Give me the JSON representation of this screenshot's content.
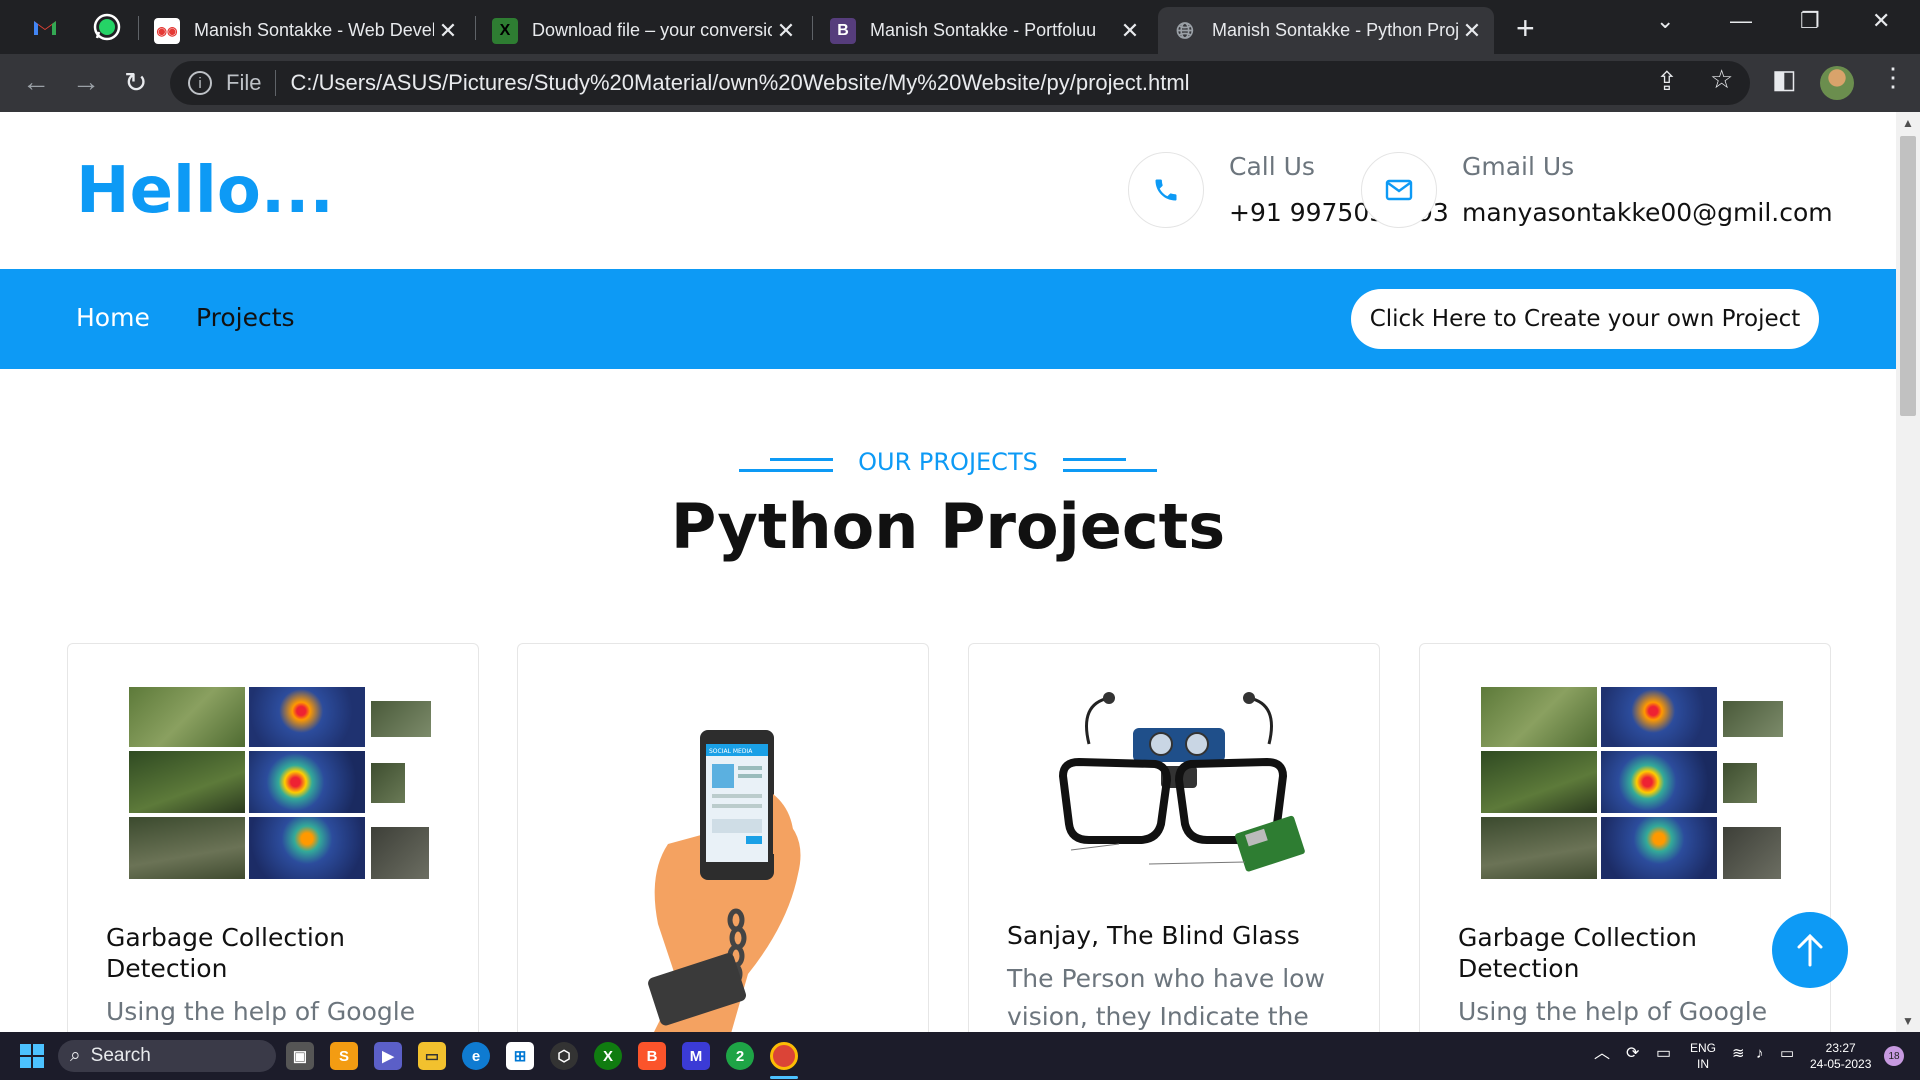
{
  "browser": {
    "tabs": [
      {
        "title": "Manish Sontakke - Web Develo",
        "favicon": "portfolio-face-icon",
        "close": "✕"
      },
      {
        "title": "Download file – your conversio",
        "favicon": "download-x-icon",
        "close": "✕"
      },
      {
        "title": "Manish Sontakke - Portfoluu",
        "favicon": "bootstrap-b-icon",
        "close": "✕"
      },
      {
        "title": "Manish Sontakke - Python Proj",
        "favicon": "globe-icon",
        "close": "✕",
        "active": true
      }
    ],
    "address": {
      "scheme_label": "File",
      "url": "C:/Users/ASUS/Pictures/Study%20Material/own%20Website/My%20Website/py/project.html"
    }
  },
  "header": {
    "greeting": "Hello...",
    "call": {
      "label": "Call Us",
      "value": "+91 9975039493"
    },
    "mail": {
      "label": "Gmail Us",
      "value": "manyasontakke00@gmil.com"
    }
  },
  "nav": {
    "items": [
      "Home",
      "Projects"
    ],
    "cta": "Click Here to Create your own Project"
  },
  "section": {
    "subtitle": "OUR PROJECTS",
    "title": "Python Projects"
  },
  "projects": [
    {
      "title_line1": "Garbage Collection",
      "title_line2": "Detection",
      "desc": "Using the help of Google",
      "image": "satellite-heatmap-image"
    },
    {
      "title_line1": "",
      "title_line2": "",
      "desc": "",
      "image": "phone-addiction-image"
    },
    {
      "title_line1": "Sanjay, The Blind Glass",
      "title_line2": "",
      "desc_line1": "The Person who have low",
      "desc_line2": "vision, they Indicate the",
      "image": "smart-glasses-image"
    },
    {
      "title_line1": "Garbage Collection",
      "title_line2": "Detection",
      "desc": "Using the help of Google",
      "image": "satellite-heatmap-image"
    }
  ],
  "taskbar": {
    "search_label": "Search",
    "lang": "ENG",
    "region": "IN",
    "time": "23:27",
    "date": "24-05-2023",
    "notif_count": "18"
  },
  "colors": {
    "accent": "#0d9af5",
    "chrome_dark": "#202124",
    "chrome_mid": "#35363a"
  }
}
